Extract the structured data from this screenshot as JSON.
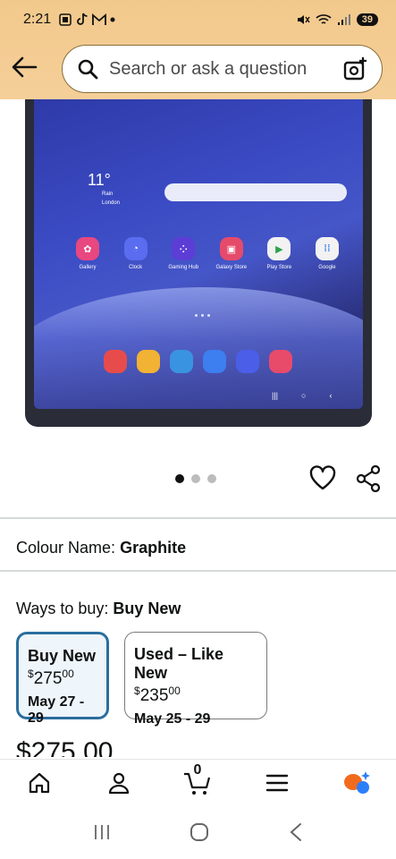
{
  "status": {
    "time": "2:21",
    "battery": "39"
  },
  "search": {
    "placeholder": "Search or ask a question"
  },
  "tablet": {
    "weather_temp": "11°",
    "weather_line1": "Rain",
    "weather_line2": "London",
    "apps": [
      {
        "label": "Gallery",
        "color": "#e8477f"
      },
      {
        "label": "Clock",
        "color": "#5a6cf0"
      },
      {
        "label": "Gaming Hub",
        "color": "#5c3dd6"
      },
      {
        "label": "Galaxy Store",
        "color": "#e64a6a"
      },
      {
        "label": "Play Store",
        "color": "#f2f2f2"
      },
      {
        "label": "Google",
        "color": "#f2f2f2"
      }
    ],
    "dock_colors": [
      "#e84b4b",
      "#f2b233",
      "#3a93e0",
      "#3d7ef0",
      "#4a5ee8",
      "#e84b6a"
    ],
    "nav_back": "‹",
    "nav_home": "○",
    "nav_recent": "|||"
  },
  "carousel": {
    "count": 3,
    "active_index": 0
  },
  "colour": {
    "label": "Colour Name:",
    "value": "Graphite"
  },
  "ways": {
    "label": "Ways to buy:",
    "value": "Buy New"
  },
  "options": [
    {
      "title": "Buy New",
      "price_currency": "$",
      "price_main": "275",
      "price_cents": "00",
      "date": "May 27 - 29"
    },
    {
      "title": "Used – Like New",
      "price_currency": "$",
      "price_main": "235",
      "price_cents": "00",
      "date": "May 25 - 29"
    }
  ],
  "price_peek": "$275.00",
  "cart": {
    "count": "0"
  },
  "colors": {
    "header": "#f5cf99",
    "selected_border": "#2a6e9e",
    "accent_orange": "#f26b1d",
    "accent_blue": "#2d7ff9"
  }
}
